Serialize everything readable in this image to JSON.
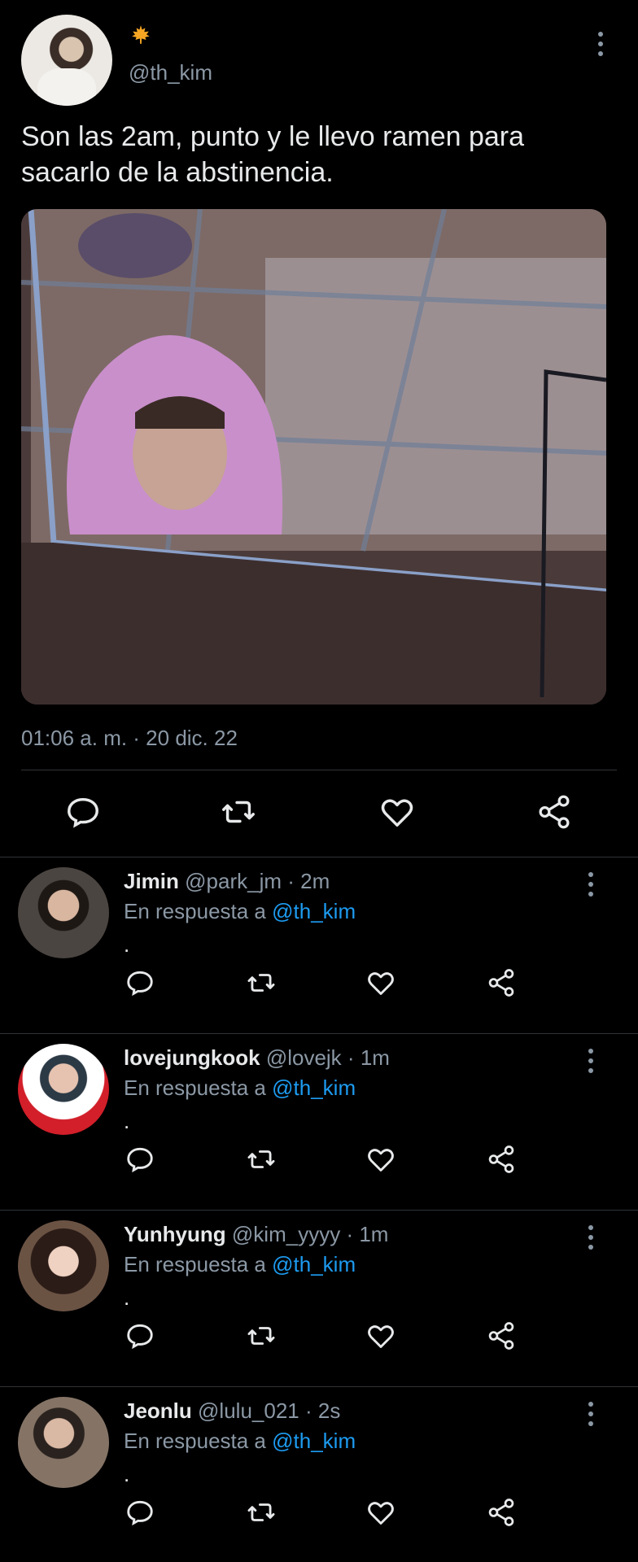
{
  "tweet": {
    "handle": "@th_kim",
    "text": "Son las 2am, punto y le llevo ramen para sacarlo de la abstinencia.",
    "timestamp": "01:06 a. m. · 20 dic. 22"
  },
  "replies": [
    {
      "name": "Jimin",
      "handle": "@park_jm",
      "time": "2m",
      "replying_prefix": "En respuesta a",
      "mention": "@th_kim",
      "text": "."
    },
    {
      "name": "lovejungkook",
      "handle": "@lovejk",
      "time": "1m",
      "replying_prefix": "En respuesta a",
      "mention": "@th_kim",
      "text": "."
    },
    {
      "name": "Yunhyung",
      "handle": "@kim_yyyy",
      "time": "1m",
      "replying_prefix": "En respuesta a",
      "mention": "@th_kim",
      "text": "."
    },
    {
      "name": "Jeonlu",
      "handle": "@lulu_021",
      "time": "2s",
      "replying_prefix": "En respuesta a",
      "mention": "@th_kim",
      "text": "."
    }
  ],
  "icons": [
    "maple-leaf-icon",
    "more-vertical-icon",
    "reply-icon",
    "retweet-icon",
    "like-icon",
    "share-icon"
  ],
  "colors": {
    "background": "#000000",
    "text": "#e7e9ea",
    "muted": "#8b98a5",
    "accent": "#1d9bf0",
    "divider": "#2f3336",
    "leaf": "#f6a623"
  }
}
